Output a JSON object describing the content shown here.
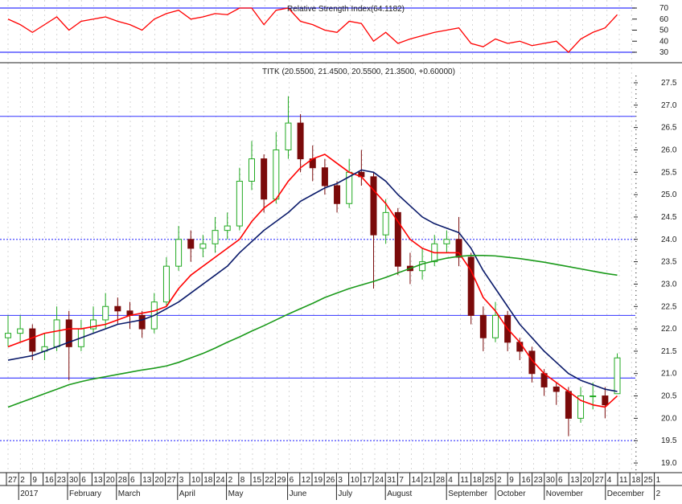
{
  "chart_data": [
    {
      "type": "line",
      "title": "Relative Strength Index(64.1182)",
      "ylim": [
        25,
        75
      ],
      "y_ticks": [
        "70",
        "60",
        "50",
        "40",
        "30"
      ],
      "y_tick_values": [
        70,
        60,
        50,
        40,
        30
      ],
      "levels": [
        70,
        30
      ],
      "series": [
        {
          "name": "RSI",
          "color": "#ff0000",
          "values": [
            60,
            55,
            48,
            55,
            62,
            50,
            58,
            60,
            62,
            58,
            55,
            50,
            60,
            65,
            68,
            60,
            62,
            65,
            64,
            70,
            70,
            55,
            68,
            70,
            58,
            55,
            50,
            48,
            58,
            56,
            40,
            48,
            38,
            42,
            45,
            48,
            50,
            52,
            38,
            35,
            42,
            38,
            40,
            36,
            38,
            40,
            30,
            42,
            48,
            52,
            64
          ]
        }
      ]
    },
    {
      "type": "candlestick",
      "title": "TITK (20.5500, 21.4500, 20.5500, 21.3500, +0.60000)",
      "ylim": [
        18.75,
        27.75
      ],
      "y_ticks": [
        "27.5",
        "27.0",
        "26.5",
        "26.0",
        "25.5",
        "25.0",
        "24.5",
        "24.0",
        "23.5",
        "23.0",
        "22.5",
        "22.0",
        "21.5",
        "21.0",
        "20.5",
        "20.0",
        "19.5",
        "19.0"
      ],
      "y_tick_values": [
        27.5,
        27.0,
        26.5,
        26.0,
        25.5,
        25.0,
        24.5,
        24.0,
        23.5,
        23.0,
        22.5,
        22.0,
        21.5,
        21.0,
        20.5,
        20.0,
        19.5,
        19.0
      ],
      "levels": [
        {
          "value": 26.75,
          "style": "solid"
        },
        {
          "value": 24.0,
          "style": "dotted"
        },
        {
          "value": 22.3,
          "style": "solid"
        },
        {
          "value": 20.9,
          "style": "solid"
        },
        {
          "value": 19.5,
          "style": "dotted"
        }
      ],
      "ohlc": [
        [
          21.8,
          22.3,
          21.6,
          21.9
        ],
        [
          21.9,
          22.3,
          21.7,
          22.0
        ],
        [
          22.0,
          22.1,
          21.3,
          21.5
        ],
        [
          21.5,
          21.9,
          21.3,
          21.6
        ],
        [
          21.6,
          22.5,
          21.5,
          22.2
        ],
        [
          22.2,
          22.4,
          20.85,
          21.6
        ],
        [
          21.6,
          22.2,
          21.5,
          22.0
        ],
        [
          22.0,
          22.5,
          21.9,
          22.2
        ],
        [
          22.2,
          22.8,
          22.0,
          22.5
        ],
        [
          22.5,
          22.7,
          22.1,
          22.4
        ],
        [
          22.4,
          22.6,
          22.0,
          22.3
        ],
        [
          22.3,
          22.4,
          21.8,
          22.0
        ],
        [
          22.0,
          22.8,
          21.9,
          22.6
        ],
        [
          22.6,
          23.6,
          22.5,
          23.4
        ],
        [
          23.4,
          24.3,
          23.3,
          24.0
        ],
        [
          24.0,
          24.2,
          23.5,
          23.8
        ],
        [
          23.8,
          24.1,
          23.6,
          23.9
        ],
        [
          23.9,
          24.5,
          23.7,
          24.2
        ],
        [
          24.2,
          24.6,
          24.0,
          24.3
        ],
        [
          24.3,
          25.6,
          24.2,
          25.3
        ],
        [
          25.3,
          26.2,
          25.1,
          25.8
        ],
        [
          25.8,
          25.9,
          24.6,
          24.9
        ],
        [
          24.9,
          26.4,
          24.8,
          26.0
        ],
        [
          26.0,
          27.2,
          25.8,
          26.6
        ],
        [
          26.6,
          26.8,
          25.5,
          25.8
        ],
        [
          25.8,
          26.1,
          25.3,
          25.6
        ],
        [
          25.6,
          25.8,
          25.0,
          25.2
        ],
        [
          25.2,
          25.3,
          24.6,
          24.8
        ],
        [
          24.8,
          25.8,
          24.7,
          25.5
        ],
        [
          25.5,
          26.0,
          25.2,
          25.4
        ],
        [
          25.4,
          25.5,
          22.9,
          24.1
        ],
        [
          24.1,
          24.9,
          23.9,
          24.6
        ],
        [
          24.6,
          24.7,
          23.2,
          23.4
        ],
        [
          23.4,
          23.7,
          23.0,
          23.3
        ],
        [
          23.3,
          23.8,
          23.1,
          23.5
        ],
        [
          23.5,
          24.1,
          23.4,
          23.9
        ],
        [
          23.9,
          24.2,
          23.7,
          24.0
        ],
        [
          24.0,
          24.5,
          23.4,
          23.6
        ],
        [
          23.6,
          23.7,
          22.1,
          22.3
        ],
        [
          22.3,
          22.5,
          21.5,
          21.8
        ],
        [
          21.8,
          22.6,
          21.7,
          22.3
        ],
        [
          22.3,
          22.4,
          21.5,
          21.7
        ],
        [
          21.7,
          21.8,
          21.3,
          21.5
        ],
        [
          21.5,
          21.6,
          20.8,
          21.0
        ],
        [
          21.0,
          21.1,
          20.5,
          20.7
        ],
        [
          20.7,
          20.8,
          20.3,
          20.6
        ],
        [
          20.6,
          20.7,
          19.6,
          20.0
        ],
        [
          20.0,
          20.7,
          19.9,
          20.5
        ],
        [
          20.5,
          20.8,
          20.2,
          20.5
        ],
        [
          20.5,
          20.7,
          20.0,
          20.3
        ],
        [
          20.55,
          21.45,
          20.55,
          21.35
        ]
      ],
      "series": [
        {
          "name": "short MA",
          "color": "#ff0000",
          "values": [
            21.6,
            21.7,
            21.8,
            21.9,
            21.95,
            22.0,
            22.0,
            22.05,
            22.1,
            22.2,
            22.3,
            22.35,
            22.4,
            22.5,
            22.9,
            23.2,
            23.4,
            23.6,
            23.8,
            24.0,
            24.4,
            24.7,
            24.9,
            25.3,
            25.6,
            25.8,
            25.9,
            25.7,
            25.5,
            25.4,
            25.1,
            24.8,
            24.4,
            24.0,
            23.8,
            23.7,
            23.7,
            23.7,
            23.3,
            22.7,
            22.4,
            22.0,
            21.7,
            21.3,
            21.0,
            20.8,
            20.6,
            20.4,
            20.3,
            20.25,
            20.5
          ]
        },
        {
          "name": "medium MA",
          "color": "#0a1a6a",
          "values": [
            21.3,
            21.35,
            21.4,
            21.5,
            21.6,
            21.7,
            21.8,
            21.9,
            22.0,
            22.1,
            22.15,
            22.2,
            22.3,
            22.45,
            22.6,
            22.8,
            23.0,
            23.2,
            23.4,
            23.7,
            23.95,
            24.2,
            24.4,
            24.6,
            24.85,
            25.0,
            25.15,
            25.25,
            25.4,
            25.55,
            25.5,
            25.3,
            25.0,
            24.75,
            24.5,
            24.35,
            24.25,
            24.15,
            23.8,
            23.3,
            22.9,
            22.5,
            22.1,
            21.8,
            21.5,
            21.25,
            21.0,
            20.85,
            20.75,
            20.65,
            20.6
          ]
        },
        {
          "name": "long MA",
          "color": "#1a9a1a",
          "values": [
            20.25,
            20.35,
            20.45,
            20.55,
            20.65,
            20.75,
            20.82,
            20.88,
            20.93,
            20.98,
            21.03,
            21.08,
            21.12,
            21.17,
            21.25,
            21.35,
            21.45,
            21.57,
            21.7,
            21.82,
            21.95,
            22.07,
            22.2,
            22.33,
            22.45,
            22.57,
            22.7,
            22.8,
            22.9,
            22.98,
            23.06,
            23.15,
            23.25,
            23.35,
            23.45,
            23.52,
            23.58,
            23.62,
            23.64,
            23.64,
            23.63,
            23.6,
            23.57,
            23.53,
            23.49,
            23.44,
            23.39,
            23.34,
            23.29,
            23.24,
            23.2
          ]
        }
      ],
      "x_day_ticks": [
        "27",
        "2",
        "9",
        "16",
        "23",
        "30",
        "6",
        "13",
        "20",
        "28",
        "6",
        "13",
        "20",
        "27",
        "3",
        "10",
        "18",
        "24",
        "2",
        "8",
        "15",
        "22",
        "29",
        "6",
        "12",
        "19",
        "26",
        "3",
        "10",
        "17",
        "24",
        "31",
        "7",
        "14",
        "21",
        "28",
        "4",
        "11",
        "18",
        "25",
        "2",
        "9",
        "16",
        "23",
        "30",
        "6",
        "13",
        "20",
        "27",
        "4",
        "11",
        "18",
        "25",
        "1"
      ],
      "x_month_labels": [
        {
          "label": "2017",
          "tick_index": 1
        },
        {
          "label": "February",
          "tick_index": 5
        },
        {
          "label": "March",
          "tick_index": 9
        },
        {
          "label": "April",
          "tick_index": 14
        },
        {
          "label": "May",
          "tick_index": 18
        },
        {
          "label": "June",
          "tick_index": 23
        },
        {
          "label": "July",
          "tick_index": 27
        },
        {
          "label": "August",
          "tick_index": 31
        },
        {
          "label": "September",
          "tick_index": 36
        },
        {
          "label": "October",
          "tick_index": 40
        },
        {
          "label": "November",
          "tick_index": 44
        },
        {
          "label": "December",
          "tick_index": 49
        },
        {
          "label": "2",
          "tick_index": 53
        }
      ],
      "colors": {
        "up": "#22aa22",
        "down": "#7a0a0a",
        "level": "#3333ff",
        "grid": "#bbbbbb"
      }
    }
  ]
}
